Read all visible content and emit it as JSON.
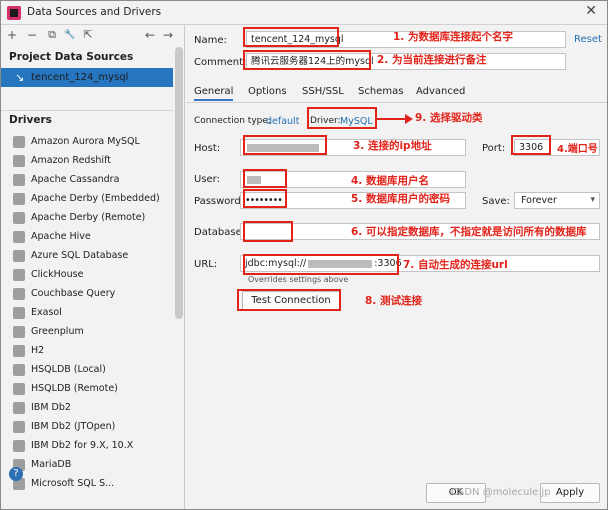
{
  "window": {
    "title": "Data Sources and Drivers",
    "close": "✕"
  },
  "toolbar": {
    "add": "+",
    "remove": "−",
    "copy": "⧉",
    "wrench": "🔧",
    "export": "⇱",
    "back": "←",
    "forward": "→"
  },
  "sidebar": {
    "data_sources_header": "Project Data Sources",
    "data_source": "tencent_124_mysql",
    "drivers_header": "Drivers",
    "drivers": [
      "Amazon Aurora MySQL",
      "Amazon Redshift",
      "Apache Cassandra",
      "Apache Derby (Embedded)",
      "Apache Derby (Remote)",
      "Apache Hive",
      "Azure SQL Database",
      "ClickHouse",
      "Couchbase Query",
      "Exasol",
      "Greenplum",
      "H2",
      "HSQLDB (Local)",
      "HSQLDB (Remote)",
      "IBM Db2",
      "IBM Db2 (JTOpen)",
      "IBM Db2 for 9.X, 10.X",
      "MariaDB",
      "Microsoft SQL S..."
    ]
  },
  "form": {
    "name_label": "Name:",
    "name_value": "tencent_124_mysql",
    "comment_label": "Comment:",
    "comment_value": "腾讯云服务器124上的mysql",
    "reset": "Reset",
    "tabs": [
      "General",
      "Options",
      "SSH/SSL",
      "Schemas",
      "Advanced"
    ],
    "connection_type_label": "Connection type:",
    "connection_type_value": "default",
    "driver_label": "Driver:",
    "driver_value": "MySQL",
    "host_label": "Host:",
    "port_label": "Port:",
    "port_value": "3306",
    "user_label": "User:",
    "password_label": "Password:",
    "password_value": "••••••••",
    "save_label": "Save:",
    "save_value": "Forever",
    "database_label": "Database:",
    "url_label": "URL:",
    "url_prefix": "jdbc:mysql://",
    "url_suffix": ":3306",
    "url_note": "Overrides settings above",
    "test_connection": "Test Connection"
  },
  "annotations": {
    "a1": "1. 为数据库连接起个名字",
    "a2": "2. 为当前连接进行备注",
    "a3": "3. 连接的ip地址",
    "a4": "4.端口号",
    "a5": "5. 数据库用户的密码",
    "a6": "6. 可以指定数据库，不指定就是访问所有的数据库",
    "a7": "7. 自动生成的连接url",
    "a8": "8. 测试连接",
    "a9": "9. 选择驱动类",
    "a_user": "4. 数据库用户名"
  },
  "footer": {
    "help": "?",
    "ok": "OK",
    "apply": "Apply",
    "watermark": "CSDN @molecule.jp"
  },
  "colors": {
    "selection": "#2675bf",
    "annotation": "#e2231a",
    "link": "#2470b3"
  }
}
